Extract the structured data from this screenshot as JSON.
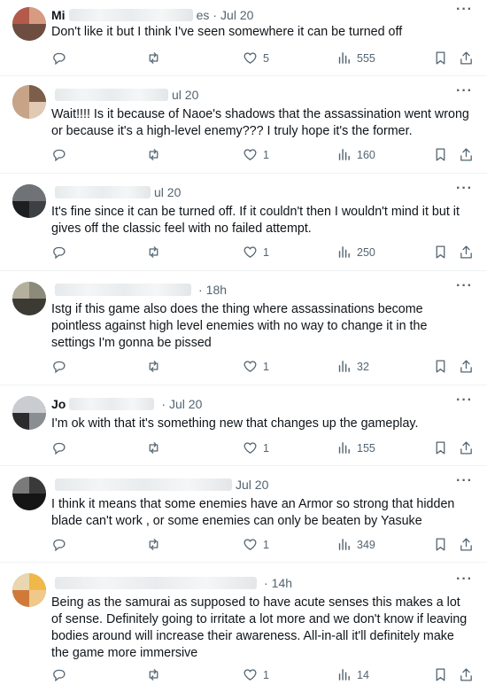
{
  "tweets": [
    {
      "username": "Mi",
      "handle": "es",
      "time": "Jul 20",
      "text": "Don't like it but I think I've seen somewhere it can be turned off",
      "likes": "5",
      "views": "555",
      "avatar_colors": [
        "#b35a4a",
        "#d79b82",
        "#6d4d3f"
      ]
    },
    {
      "username": "",
      "handle": "",
      "time": "ul 20",
      "text": "Wait!!!! Is it because of Naoe's shadows that the assassination went wrong or because it's a high-level enemy??? I truly hope it's the former.",
      "likes": "1",
      "views": "160",
      "avatar_colors": [
        "#c7a488",
        "#7d5e4a",
        "#e2c9b3"
      ]
    },
    {
      "username": "",
      "handle": "",
      "time": "ul 20",
      "text": "It's fine since it can be turned off. If it couldn't then I wouldn't mind it but it gives off the classic feel with no failed attempt.",
      "likes": "1",
      "views": "250",
      "avatar_colors": [
        "#3d4043",
        "#1c1e20",
        "#6f7377"
      ]
    },
    {
      "username": "",
      "handle": "",
      "time": "18h",
      "text": "Istg if this game also does the thing where assassinations become pointless against high level enemies with no way to change it in the settings I'm gonna be pissed",
      "likes": "1",
      "views": "32",
      "avatar_colors": [
        "#8c8a7a",
        "#3b3a33",
        "#b5b09c"
      ]
    },
    {
      "username": "Jo",
      "handle": "",
      "time": "Jul 20",
      "text": "I'm ok with that it's something new that changes up the gameplay.",
      "likes": "1",
      "views": "155",
      "avatar_colors": [
        "#2b2b2e",
        "#8a8d91",
        "#c9ccd0"
      ]
    },
    {
      "username": "",
      "handle": "",
      "time": "Jul 20",
      "text": "I think it means that some enemies have an Armor so strong that hidden blade can't work , or some enemies can only be beaten by Yasuke",
      "likes": "1",
      "views": "349",
      "avatar_colors": [
        "#3a3a3a",
        "#7a7a7a",
        "#151515"
      ]
    },
    {
      "username": "",
      "handle": "",
      "time": "14h",
      "text": "Being as the samurai as supposed to have acute senses this makes a lot of sense. Definitely going to irritate a lot more and we don't know if leaving bodies around will increase their awareness. All-in-all it'll definitely make the game more immersive",
      "likes": "1",
      "views": "14",
      "avatar_colors": [
        "#f0b84a",
        "#e8d7b0",
        "#d07a3a"
      ]
    }
  ],
  "icons": {
    "reply": "reply-icon",
    "retweet": "retweet-icon",
    "like": "heart-icon",
    "views": "views-chart-icon",
    "bookmark": "bookmark-icon",
    "share": "share-icon",
    "more": "more-dots-icon"
  },
  "more_glyph": "···"
}
